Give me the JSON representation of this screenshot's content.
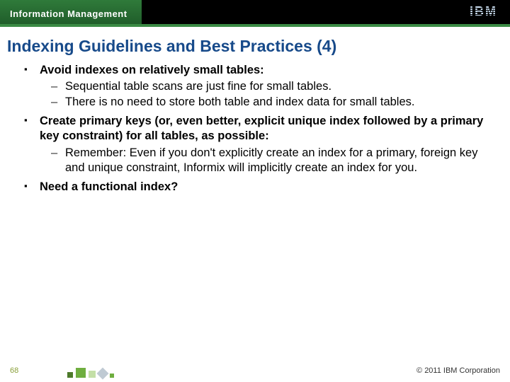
{
  "header": {
    "band": "Information Management",
    "logo_text": "IBM"
  },
  "title": "Indexing Guidelines and Best Practices (4)",
  "bullets": [
    {
      "text": "Avoid indexes on relatively small tables:",
      "sub": [
        "Sequential table scans are just fine for small tables.",
        "There is no need to store both table and index data for small tables."
      ]
    },
    {
      "text": "Create primary keys (or, even better, explicit unique index followed by a primary key constraint) for all tables, as possible:",
      "sub": [
        "Remember: Even if you don't explicitly create an index for a primary, foreign key and unique constraint, Informix will implicitly create an index for you."
      ]
    },
    {
      "text": "Need a functional index?",
      "sub": []
    }
  ],
  "footer": {
    "page": "68",
    "copyright": "© 2011 IBM Corporation"
  }
}
